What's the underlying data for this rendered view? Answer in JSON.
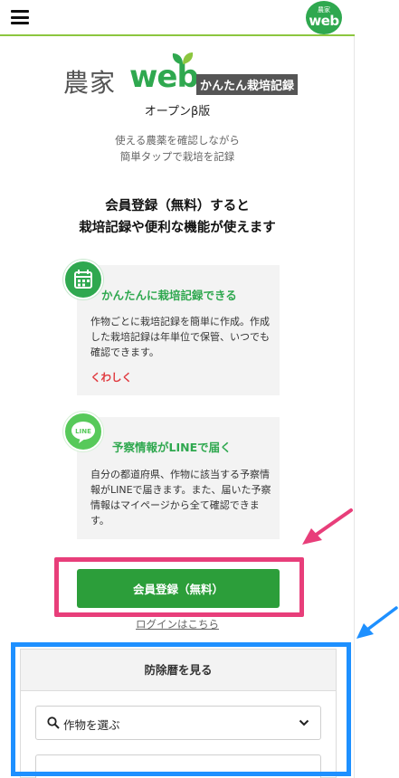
{
  "header": {
    "menu_icon": "hamburger-icon",
    "logo_small": "農家",
    "logo_big": "web"
  },
  "hero": {
    "logo_kanji": "農家",
    "logo_web": "web",
    "logo_sub": "かんたん栽培記録",
    "beta_label": "オープンβ版",
    "tagline_line1": "使える農薬を確認しながら",
    "tagline_line2": "簡単タップで栽培を記録"
  },
  "headline": {
    "line1": "会員登録（無料）すると",
    "line2": "栽培記録や便利な機能が使えます"
  },
  "features": [
    {
      "icon": "calendar-icon",
      "title": "かんたんに栽培記録できる",
      "body": "作物ごとに栽培記録を簡単に作成。作成した栽培記録は年単位で保管、いつでも確認できます。",
      "link": "くわしく"
    },
    {
      "icon": "line-icon",
      "icon_text": "LINE",
      "title": "予察情報がLINEで届く",
      "body": "自分の都道府県、作物に該当する予察情報がLINEで届きます。また、届いた予察情報はマイページから全て確認できます。"
    }
  ],
  "cta": {
    "register_label": "会員登録（無料）",
    "login_label": "ログインはこちら"
  },
  "panel": {
    "title": "防除暦を見る",
    "select_placeholder": "作物を選ぶ",
    "select_icon": "search-icon"
  },
  "colors": {
    "brand_green": "#2fa84f",
    "button_green": "#2c9e3a",
    "link_red": "#e0393e",
    "highlight_pink": "#e83e7a",
    "highlight_blue": "#1e90ff"
  }
}
